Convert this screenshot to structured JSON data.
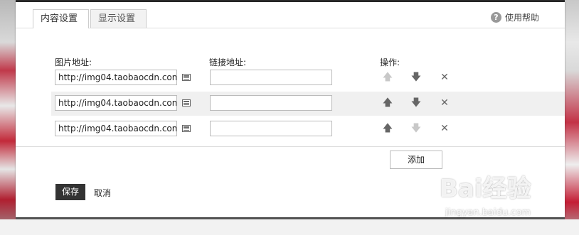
{
  "tabs": [
    {
      "label": "内容设置",
      "active": true
    },
    {
      "label": "显示设置",
      "active": false
    }
  ],
  "help": {
    "label": "使用帮助",
    "icon": "question-icon"
  },
  "columns": {
    "image_url": "图片地址:",
    "link_url": "链接地址:",
    "actions": "操作:"
  },
  "rows": [
    {
      "image_url": "http://img04.taobaocdn.com/",
      "link_url": "",
      "up_enabled": false,
      "down_enabled": true
    },
    {
      "image_url": "http://img04.taobaocdn.com/",
      "link_url": "",
      "up_enabled": true,
      "down_enabled": true
    },
    {
      "image_url": "http://img04.taobaocdn.com/",
      "link_url": "",
      "up_enabled": true,
      "down_enabled": false
    }
  ],
  "icons": {
    "picker": "image-picker-icon",
    "up": "arrow-up-icon",
    "down": "arrow-down-icon",
    "delete": "close-icon"
  },
  "add_label": "添加",
  "save_label": "保存",
  "cancel_label": "取消",
  "watermark": {
    "logo": "Bai经验",
    "url": "jingyan.baidu.com"
  }
}
